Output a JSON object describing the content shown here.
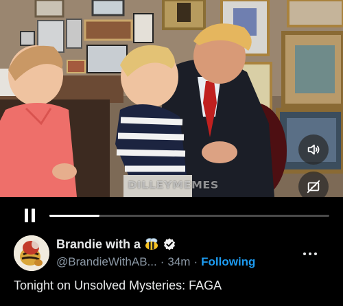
{
  "video": {
    "watermark": "DILLEYMEMES",
    "progress": 0.18,
    "controls": {
      "pause_icon": "pause-icon",
      "volume_icon": "volume-icon",
      "pip_icon": "pip-icon"
    }
  },
  "post": {
    "display_name": "Brandie with a",
    "name_emoji_icon": "bee-icon",
    "verified_icon": "verified-badge-icon",
    "handle": "@BrandieWithAB...",
    "separator": "·",
    "time": "34m",
    "follow_status": "Following",
    "more_icon": "more-icon",
    "text": "Tonight on Unsolved Mysteries: FAGA"
  },
  "colors": {
    "background": "#000000",
    "accent": "#1d9bf0",
    "muted": "#8b98a5",
    "text": "#e7e9ea"
  }
}
